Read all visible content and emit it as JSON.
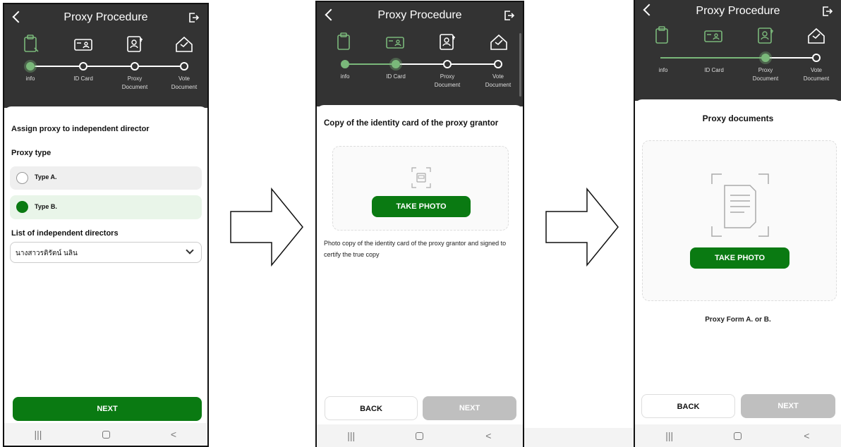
{
  "header": {
    "title": "Proxy Procedure"
  },
  "steps": [
    "info",
    "ID Card",
    "Proxy\nDocument",
    "Vote\nDocument"
  ],
  "screen1": {
    "heading": "Assign proxy to independent director",
    "proxy_type_label": "Proxy type",
    "option_a": "Type A.",
    "option_b": "Type B.",
    "directors_label": "List of independent directors",
    "director_selected": "นางสาวรติรัตน์ นลิน",
    "next": "NEXT"
  },
  "screen2": {
    "heading": "Copy of the identity card of the proxy grantor",
    "take_photo": "TAKE PHOTO",
    "description": "Photo copy of the identity card of the proxy grantor and signed to certify the true copy",
    "back": "BACK",
    "next": "NEXT"
  },
  "screen3": {
    "heading": "Proxy documents",
    "take_photo": "TAKE PHOTO",
    "caption": "Proxy Form A. or B.",
    "back": "BACK",
    "next": "NEXT"
  },
  "colors": {
    "accent": "#0a7a12",
    "header": "#333333",
    "selected_bg": "#e9f5e9",
    "step_active": "#7ab87a",
    "disabled": "#bfbfbf"
  }
}
